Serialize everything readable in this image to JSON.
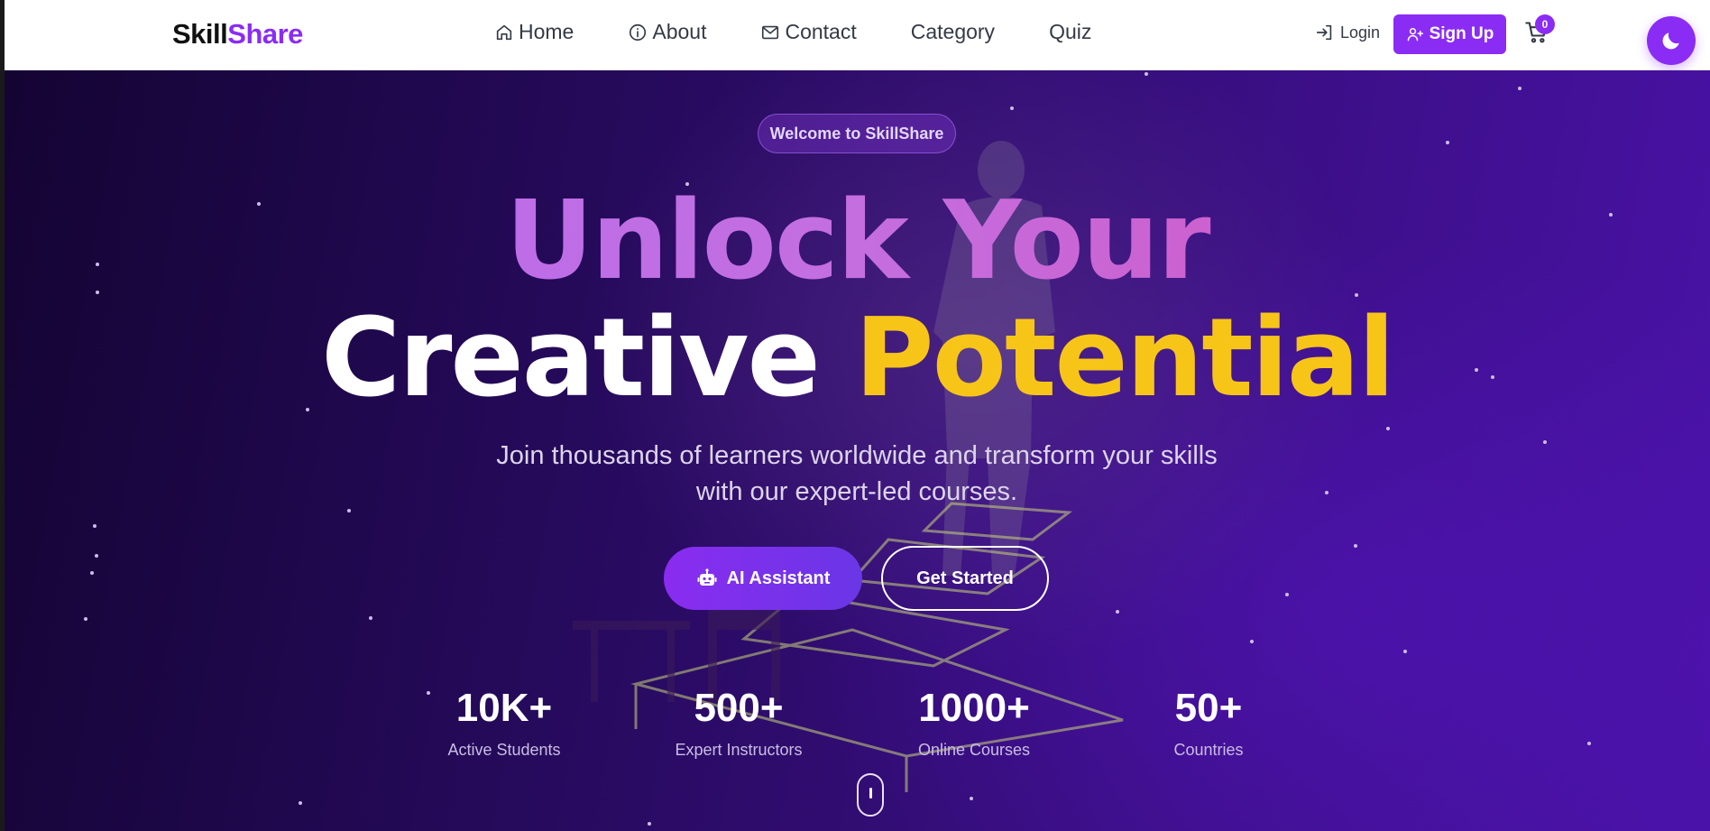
{
  "nav": {
    "logo_part1": "Skill",
    "logo_part2": "Share",
    "links": [
      {
        "label": "Home",
        "icon": "home-icon"
      },
      {
        "label": "About",
        "icon": "info-icon"
      },
      {
        "label": "Contact",
        "icon": "mail-icon"
      },
      {
        "label": "Category"
      },
      {
        "label": "Quiz"
      }
    ],
    "login_label": "Login",
    "signup_label": "Sign Up",
    "cart_count": "0",
    "theme_icon": "moon-icon"
  },
  "hero": {
    "badge": "Welcome to SkillShare",
    "headline_line1": "Unlock Your",
    "headline_line2_white": "Creative",
    "headline_line2_yellow": "Potential",
    "subtitle_line1": "Join thousands of learners worldwide and transform your skills",
    "subtitle_line2": "with our expert-led courses.",
    "ai_button": "AI Assistant",
    "start_button": "Get Started",
    "stats": [
      {
        "value": "10K+",
        "label": "Active Students"
      },
      {
        "value": "500+",
        "label": "Expert Instructors"
      },
      {
        "value": "1000+",
        "label": "Online Courses"
      },
      {
        "value": "50+",
        "label": "Countries"
      }
    ]
  },
  "colors": {
    "brand_purple": "#8b2cf5",
    "accent_yellow": "#f7c518",
    "hero_dark": "#140433",
    "hero_light": "#4a12a8"
  }
}
